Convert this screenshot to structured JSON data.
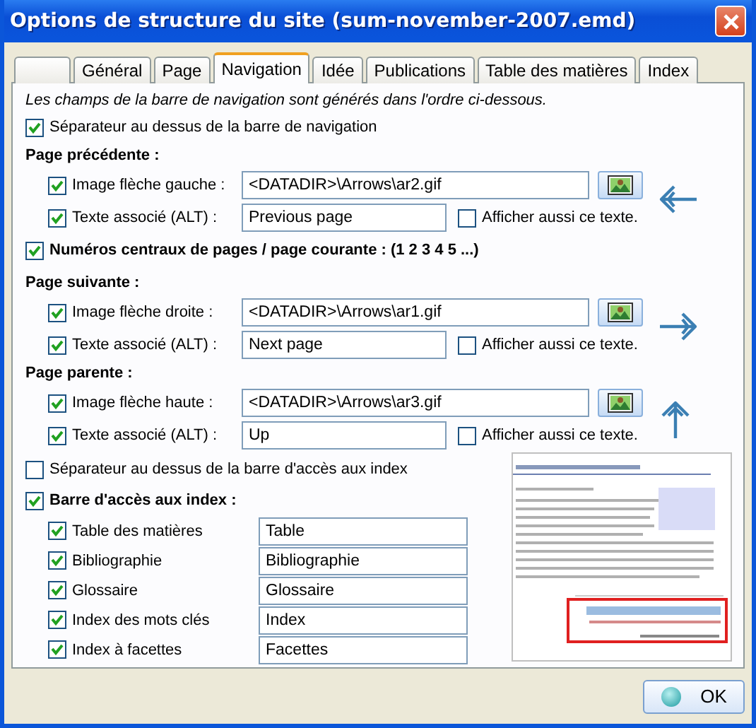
{
  "window": {
    "title": "Options de structure du site (sum-november-2007.emd)"
  },
  "tabs": [
    {
      "selected": false
    },
    {
      "label": "Général",
      "selected": false
    },
    {
      "label": "Page",
      "selected": false
    },
    {
      "label": "Navigation",
      "selected": true
    },
    {
      "label": "Idée",
      "selected": false
    },
    {
      "label": "Publications",
      "selected": false
    },
    {
      "label": "Table des matières",
      "selected": false
    },
    {
      "label": "Index",
      "selected": false
    }
  ],
  "note": "Les champs de la barre de navigation sont générés dans l'ordre ci-dessous.",
  "nav_separator": {
    "label": "Séparateur au dessus de la barre de navigation",
    "checked": true
  },
  "blocks": [
    {
      "kind": "nav",
      "heading": "Page précédente :",
      "arrow_icon": {
        "kind": "left"
      },
      "image": {
        "label": "Image flèche gauche :",
        "checked": true,
        "value": "<DATADIR>\\Arrows\\ar2.gif"
      },
      "alt": {
        "label": "Texte associé (ALT) :",
        "checked": true,
        "value": "Previous page"
      },
      "show_text": {
        "label": "Afficher aussi ce texte.",
        "checked": false
      }
    },
    {
      "kind": "check",
      "label": "Numéros centraux de pages / page courante  : (1 2 3 4 5 ...)",
      "checked": true
    },
    {
      "kind": "nav",
      "heading": "Page suivante :",
      "arrow_icon": {
        "kind": "right"
      },
      "image": {
        "label": "Image flèche droite :",
        "checked": true,
        "value": "<DATADIR>\\Arrows\\ar1.gif"
      },
      "alt": {
        "label": "Texte associé (ALT) :",
        "checked": true,
        "value": "Next page"
      },
      "show_text": {
        "label": "Afficher aussi ce texte.",
        "checked": false
      }
    },
    {
      "kind": "nav",
      "heading": "Page parente :",
      "arrow_icon": {
        "kind": "up"
      },
      "image": {
        "label": "Image flèche haute :",
        "checked": true,
        "value": "<DATADIR>\\Arrows\\ar3.gif"
      },
      "alt": {
        "label": "Texte associé (ALT) :",
        "checked": true,
        "value": "Up"
      },
      "show_text": {
        "label": "Afficher aussi ce texte.",
        "checked": false
      }
    }
  ],
  "index_separator": {
    "label": "Séparateur au dessus de la barre d'accès aux index",
    "checked": false
  },
  "index_bar": {
    "label": "Barre d'accès aux index :",
    "checked": true
  },
  "index_items": [
    {
      "label": "Table des matières",
      "checked": true,
      "value": "Table"
    },
    {
      "label": "Bibliographie",
      "checked": true,
      "value": "Bibliographie"
    },
    {
      "label": "Glossaire",
      "checked": true,
      "value": "Glossaire"
    },
    {
      "label": "Index des mots clés",
      "checked": true,
      "value": "Index"
    },
    {
      "label": "Index à facettes",
      "checked": true,
      "value": "Facettes"
    }
  ],
  "ok_button": "OK"
}
